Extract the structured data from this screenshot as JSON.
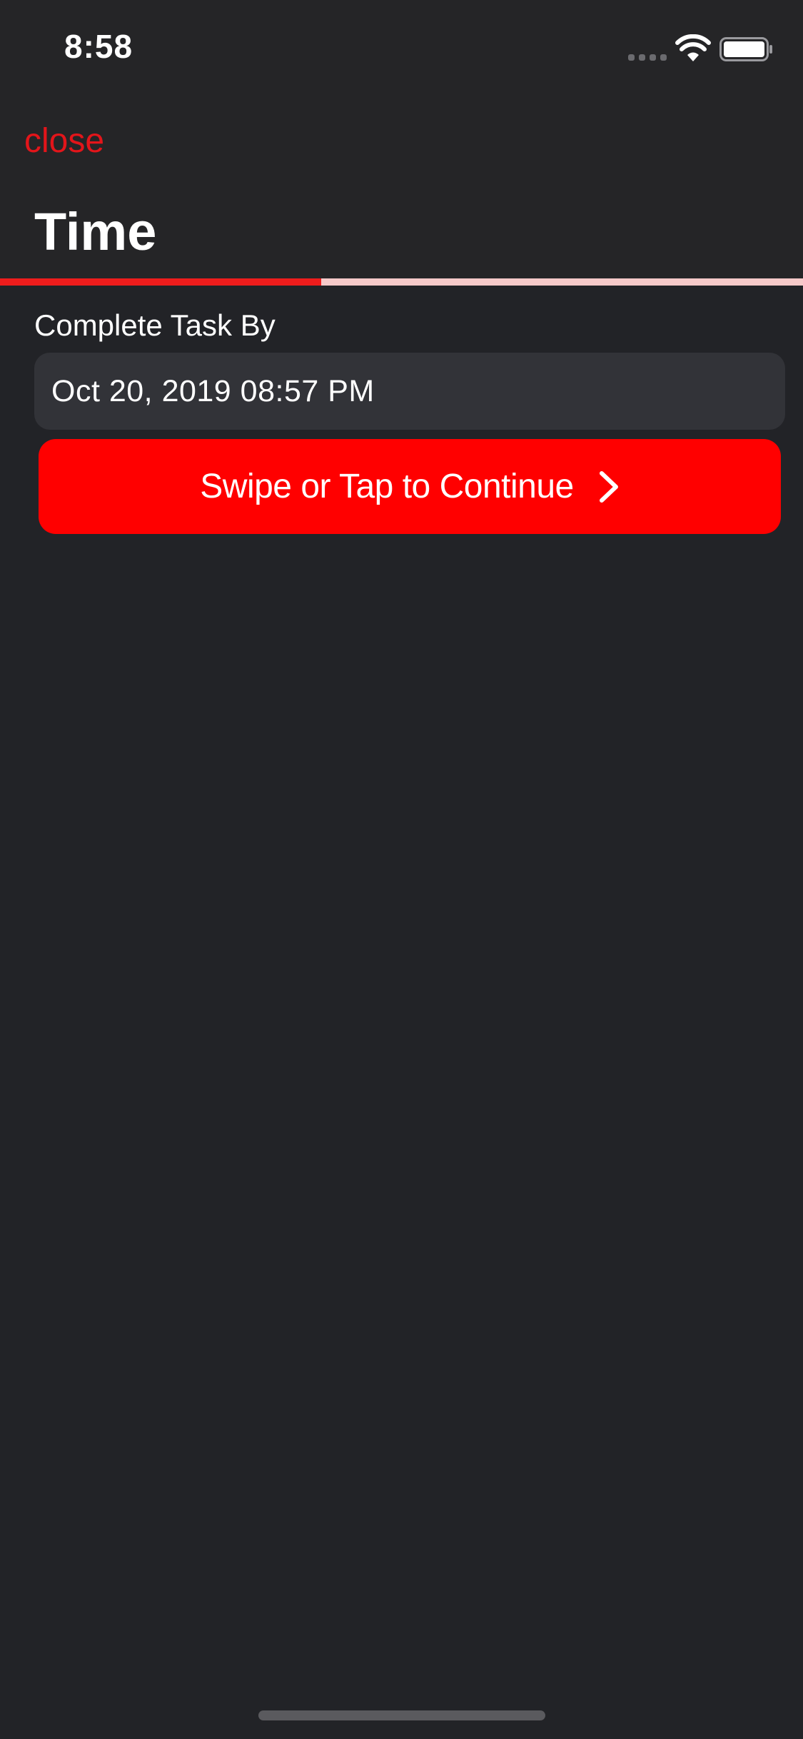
{
  "status_bar": {
    "time": "8:58",
    "icons": [
      "signal-dots-icon",
      "wifi-icon",
      "battery-icon"
    ]
  },
  "header": {
    "close_label": "close",
    "title": "Time"
  },
  "progress": {
    "fraction": 0.4
  },
  "form": {
    "field_label": "Complete Task By",
    "date_value": "Oct 20, 2019 08:57 PM"
  },
  "continue_button": {
    "label": "Swipe or Tap to Continue",
    "icon": "chevron-right-icon"
  },
  "colors": {
    "accent": "#ff0000",
    "close_text": "#e3151a",
    "background": "#222327",
    "header_background": "#252527",
    "field_background": "#323338",
    "progress_track": "#f6c9c9"
  }
}
